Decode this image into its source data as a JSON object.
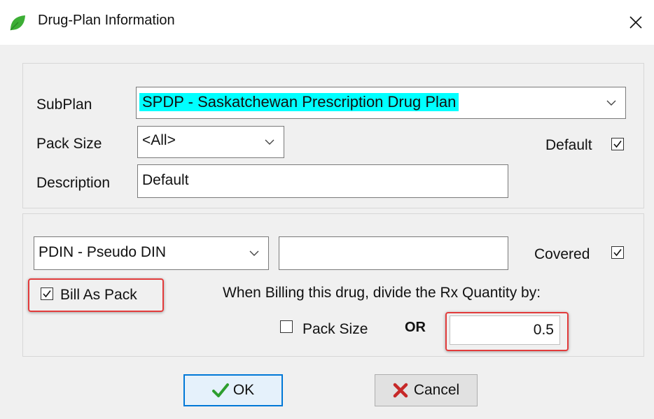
{
  "window": {
    "title": "Drug-Plan Information"
  },
  "subplan": {
    "label": "SubPlan",
    "value": "SPDP - Saskatchewan Prescription Drug Plan"
  },
  "pack_size": {
    "label": "Pack Size",
    "value": "<All>"
  },
  "default": {
    "label": "Default",
    "checked": true
  },
  "description": {
    "label": "Description",
    "value": "Default"
  },
  "din_type": {
    "value": "PDIN - Pseudo DIN"
  },
  "din_field": {
    "value": ""
  },
  "covered": {
    "label": "Covered",
    "checked": true
  },
  "bill_as_pack": {
    "label": "Bill As Pack",
    "checked": true
  },
  "billing": {
    "instruction": "When Billing this drug, divide the Rx Quantity by:",
    "pack_size_label": "Pack Size",
    "pack_size_checked": false,
    "or_label": "OR",
    "quantity_value": "0.5"
  },
  "buttons": {
    "ok_label": "OK",
    "cancel_label": "Cancel"
  },
  "colors": {
    "selection_highlight": "#00ffff",
    "ok_icon": "#2e9e2e",
    "cancel_icon": "#c62828",
    "annotation_box": "#e23b3b",
    "leaf_icon": "#3cae35"
  }
}
